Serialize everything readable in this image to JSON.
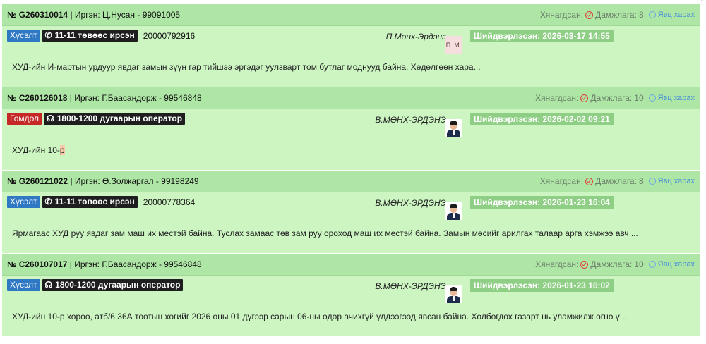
{
  "labels": {
    "reviewed": "Хянагдсан:",
    "transfer_prefix": "Дамжлага:",
    "view_progress": "Явц харах",
    "resolved_prefix": "Шийдвэрлэсэн:"
  },
  "colors": {
    "card_bg": "#ccf5c2",
    "header_bg": "#aee6a5",
    "resolved_badge": "#8fcf85",
    "type_request": "#2f78c4",
    "type_complaint": "#c62828",
    "channel_badge": "#1e1e1e",
    "link": "#4a90d9",
    "reviewed_icon": "#e0403a"
  },
  "cards": [
    {
      "id": "№ G260310014",
      "citizen": "| Иргэн: Ц.Нусан - 99091005",
      "transfer_count": "8",
      "type": "Хүсэлт",
      "type_color": "blue",
      "channel_icon": "phone-icon",
      "channel": "11-11 төвөөс ирсэн",
      "doc_number": "20000792916",
      "officer": "П.Мөнх-Эрдэнэ",
      "avatar": "initials",
      "avatar_initials": "П. М.",
      "resolved": "Шийдвэрлэсэн: 2026-03-17 14:55",
      "summary": "ХУД-ийн И-мартын урдуур явдаг замын зүүн гар тийшээ эргэдэг уулзварт том бутлаг моднууд байна. Хөдөлгөөн хара...",
      "summary_highlight": ""
    },
    {
      "id": "№ C260126018",
      "citizen": "| Иргэн: Г.Баасандорж - 99546848",
      "transfer_count": "10",
      "type": "Гомдол",
      "type_color": "red",
      "channel_icon": "headset-icon",
      "channel": "1800-1200 дугаарын оператор",
      "doc_number": "",
      "officer": "В.МӨНХ-ЭРДЭНЭ",
      "avatar": "photo",
      "avatar_initials": "",
      "resolved": "Шийдвэрлэсэн: 2026-02-02 09:21",
      "summary": "ХУД-ийн 10-",
      "summary_highlight": "р"
    },
    {
      "id": "№ G260121022",
      "citizen": "| Иргэн: Ө.Золжаргал - 99198249",
      "transfer_count": "8",
      "type": "Хүсэлт",
      "type_color": "blue",
      "channel_icon": "phone-icon",
      "channel": "11-11 төвөөс ирсэн",
      "doc_number": "20000778364",
      "officer": "В.МӨНХ-ЭРДЭНЭ",
      "avatar": "photo",
      "avatar_initials": "",
      "resolved": "Шийдвэрлэсэн: 2026-01-23 16:04",
      "summary": "Ярмагаас ХУД руу явдаг зам маш их местэй байна. Туслах замаас төв зам руу ороход маш их местэй байна. Замын мөсийг арилгах талаар арга хэмжээ авч ...",
      "summary_highlight": ""
    },
    {
      "id": "№ C260107017",
      "citizen": "| Иргэн: Г.Баасандорж - 99546848",
      "transfer_count": "10",
      "type": "Хүсэлт",
      "type_color": "blue",
      "channel_icon": "headset-icon",
      "channel": "1800-1200 дугаарын оператор",
      "doc_number": "",
      "officer": "В.МӨНХ-ЭРДЭНЭ",
      "avatar": "photo",
      "avatar_initials": "",
      "resolved": "Шийдвэрлэсэн: 2026-01-23 16:02",
      "summary": "ХУД-ийн 10-р хороо, атб/6 36А тоотын хогийг 2026 оны 01 дүгээр сарын 06-ны өдөр ачихгүй үлдээгээд явсан байна. Холбогдох газарт нь уламжилж өгнө ү...",
      "summary_highlight": ""
    }
  ]
}
